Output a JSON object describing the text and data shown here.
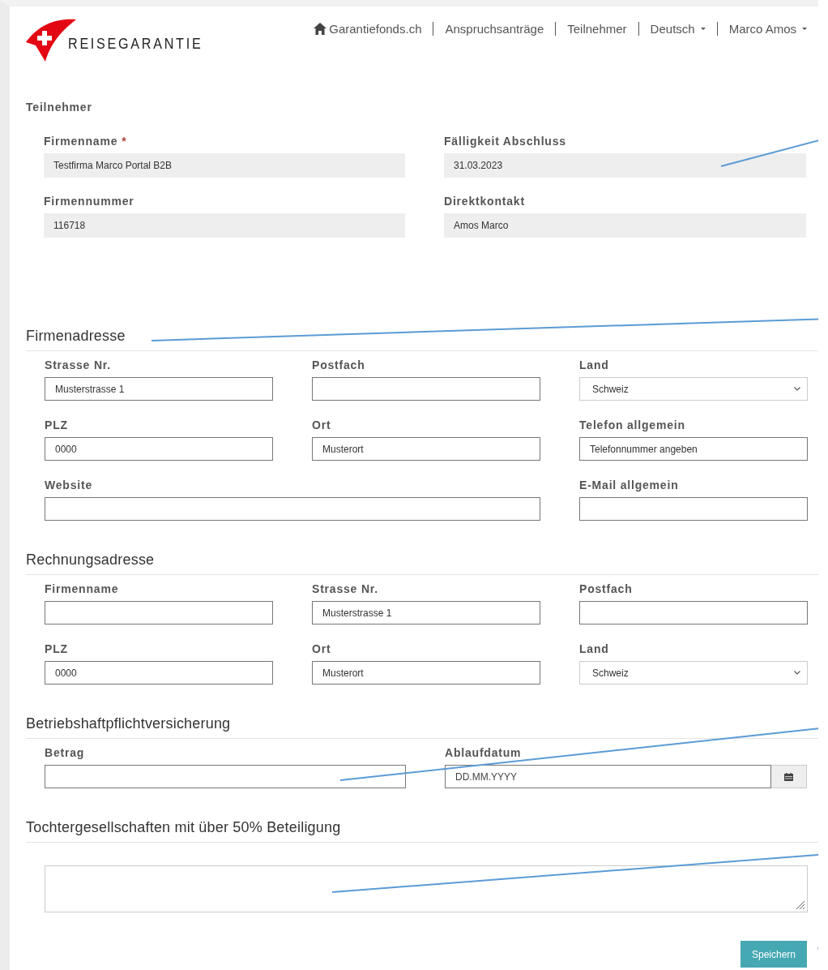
{
  "header": {
    "brand": "REISEGARANTIE",
    "nav": [
      {
        "label": "Garantiefonds.ch",
        "kind": "home"
      },
      {
        "label": "Anspruchsanträge",
        "kind": "plain"
      },
      {
        "label": "Teilnehmer",
        "kind": "plain"
      },
      {
        "label": "Deutsch",
        "kind": "dropdown"
      },
      {
        "label": "Marco Amos",
        "kind": "dropdown"
      }
    ]
  },
  "participant": {
    "title": "Teilnehmer",
    "fields": [
      {
        "label": "Firmenname",
        "required_mark": "*",
        "value": "Testfirma Marco Portal B2B"
      },
      {
        "label": "Fälligkeit Abschluss",
        "value": "31.03.2023"
      },
      {
        "label": "Firmennummer",
        "value": "116718"
      },
      {
        "label": "Direktkontakt",
        "value": "Amos Marco"
      }
    ]
  },
  "sections": [
    {
      "title": "Firmenadresse",
      "fields": [
        {
          "label": "Strasse Nr.",
          "kind": "input",
          "value": "Musterstrasse 1"
        },
        {
          "label": "Postfach",
          "kind": "input"
        },
        {
          "label": "Land",
          "kind": "select",
          "value": "Schweiz"
        },
        {
          "label": "PLZ",
          "kind": "input",
          "value": "0000"
        },
        {
          "label": "Ort",
          "kind": "input",
          "value": "Musterort"
        },
        {
          "label": "Telefon allgemein",
          "kind": "input",
          "value": "Telefonnummer angeben"
        },
        {
          "label": "Website",
          "kind": "wide-input"
        },
        {
          "label": "E-Mail allgemein",
          "kind": "input"
        }
      ]
    },
    {
      "title": "Rechnungsadresse",
      "fields": [
        {
          "label": "Firmenname",
          "kind": "input"
        },
        {
          "label": "Strasse Nr.",
          "kind": "input",
          "value": "Musterstrasse 1"
        },
        {
          "label": "Postfach",
          "kind": "input"
        },
        {
          "label": "PLZ",
          "kind": "input",
          "value": "0000"
        },
        {
          "label": "Ort",
          "kind": "input",
          "value": "Musterort"
        },
        {
          "label": "Land",
          "kind": "select",
          "value": "Schweiz"
        }
      ]
    },
    {
      "title": "Betriebshaftpflichtversicherung",
      "fields": [
        {
          "label": "Betrag",
          "kind": "input"
        },
        {
          "label": "Ablaufdatum",
          "kind": "date",
          "placeholder": "DD.MM.YYYY"
        }
      ]
    },
    {
      "title": "Tochtergesellschaften mit über 50% Beteiligung",
      "fields": [
        {
          "kind": "textarea"
        }
      ]
    }
  ],
  "save_button": "Speichern"
}
